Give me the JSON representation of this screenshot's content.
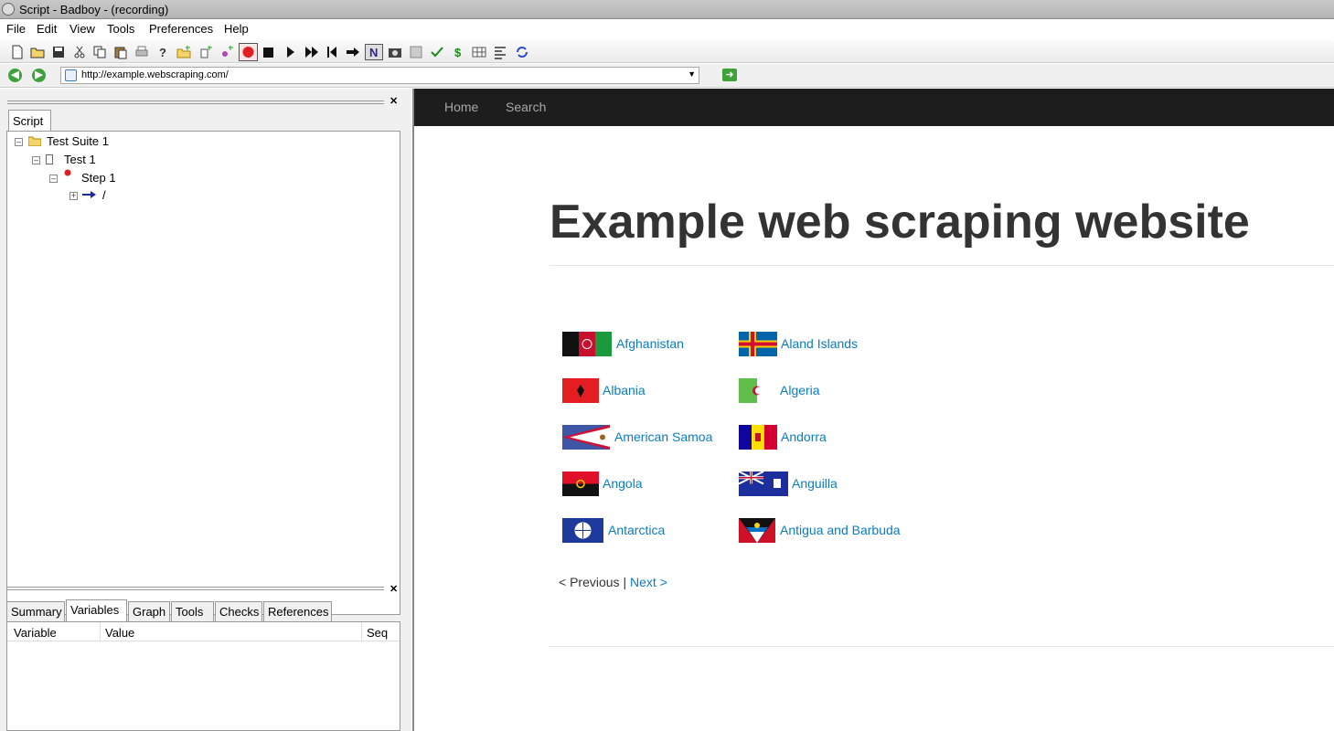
{
  "window": {
    "title": "Script - Badboy - (recording)"
  },
  "menu": [
    "File",
    "Edit",
    "View",
    "Tools",
    "Preferences",
    "Help"
  ],
  "address": {
    "url": "http://example.webscraping.com/"
  },
  "script_panel": {
    "tab": "Script",
    "tree": {
      "suite": "Test Suite 1",
      "test": "Test 1",
      "step": "Step 1",
      "request": "/"
    }
  },
  "bottom_panel": {
    "tabs": [
      "Summary",
      "Variables",
      "Graph",
      "Tools",
      "Checks",
      "References"
    ],
    "active_tab": "Variables",
    "columns": [
      "Variable",
      "Value",
      "Seq"
    ]
  },
  "site": {
    "nav": [
      "Home",
      "Search"
    ],
    "heading": "Example web scraping website",
    "countries_left": [
      "Afghanistan",
      "Albania",
      "American Samoa",
      "Angola",
      "Antarctica"
    ],
    "countries_right": [
      "Aland Islands",
      "Algeria",
      "Andorra",
      "Anguilla",
      "Antigua and Barbuda"
    ],
    "pager": {
      "prev": "< Previous",
      "sep": "|",
      "next": "Next >"
    }
  },
  "colors": {
    "link": "#0a7dc2",
    "navbar": "#1d1d1d",
    "heading": "#333333"
  }
}
